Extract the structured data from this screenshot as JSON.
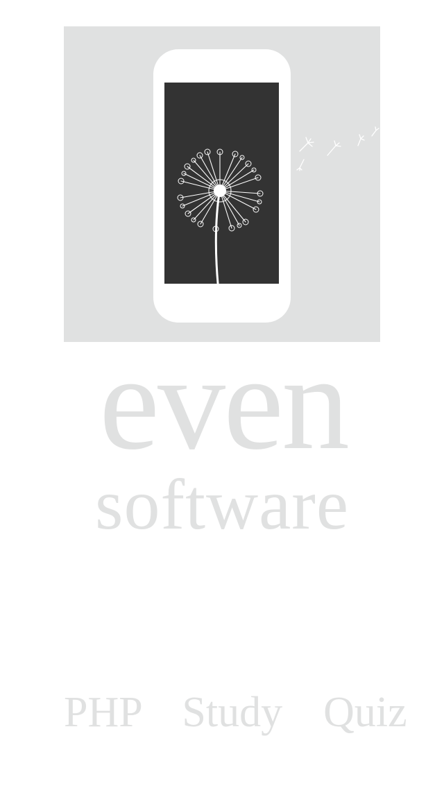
{
  "logo": {
    "brand_main": "even",
    "brand_sub": "software",
    "icon": "dandelion-phone-icon"
  },
  "app": {
    "name": "PHP  Study  Quiz"
  },
  "colors": {
    "background": "#ffffff",
    "logo_box": "#e0e1e1",
    "phone_body": "#ffffff",
    "phone_screen": "#333333",
    "text": "#e0e1e1"
  }
}
